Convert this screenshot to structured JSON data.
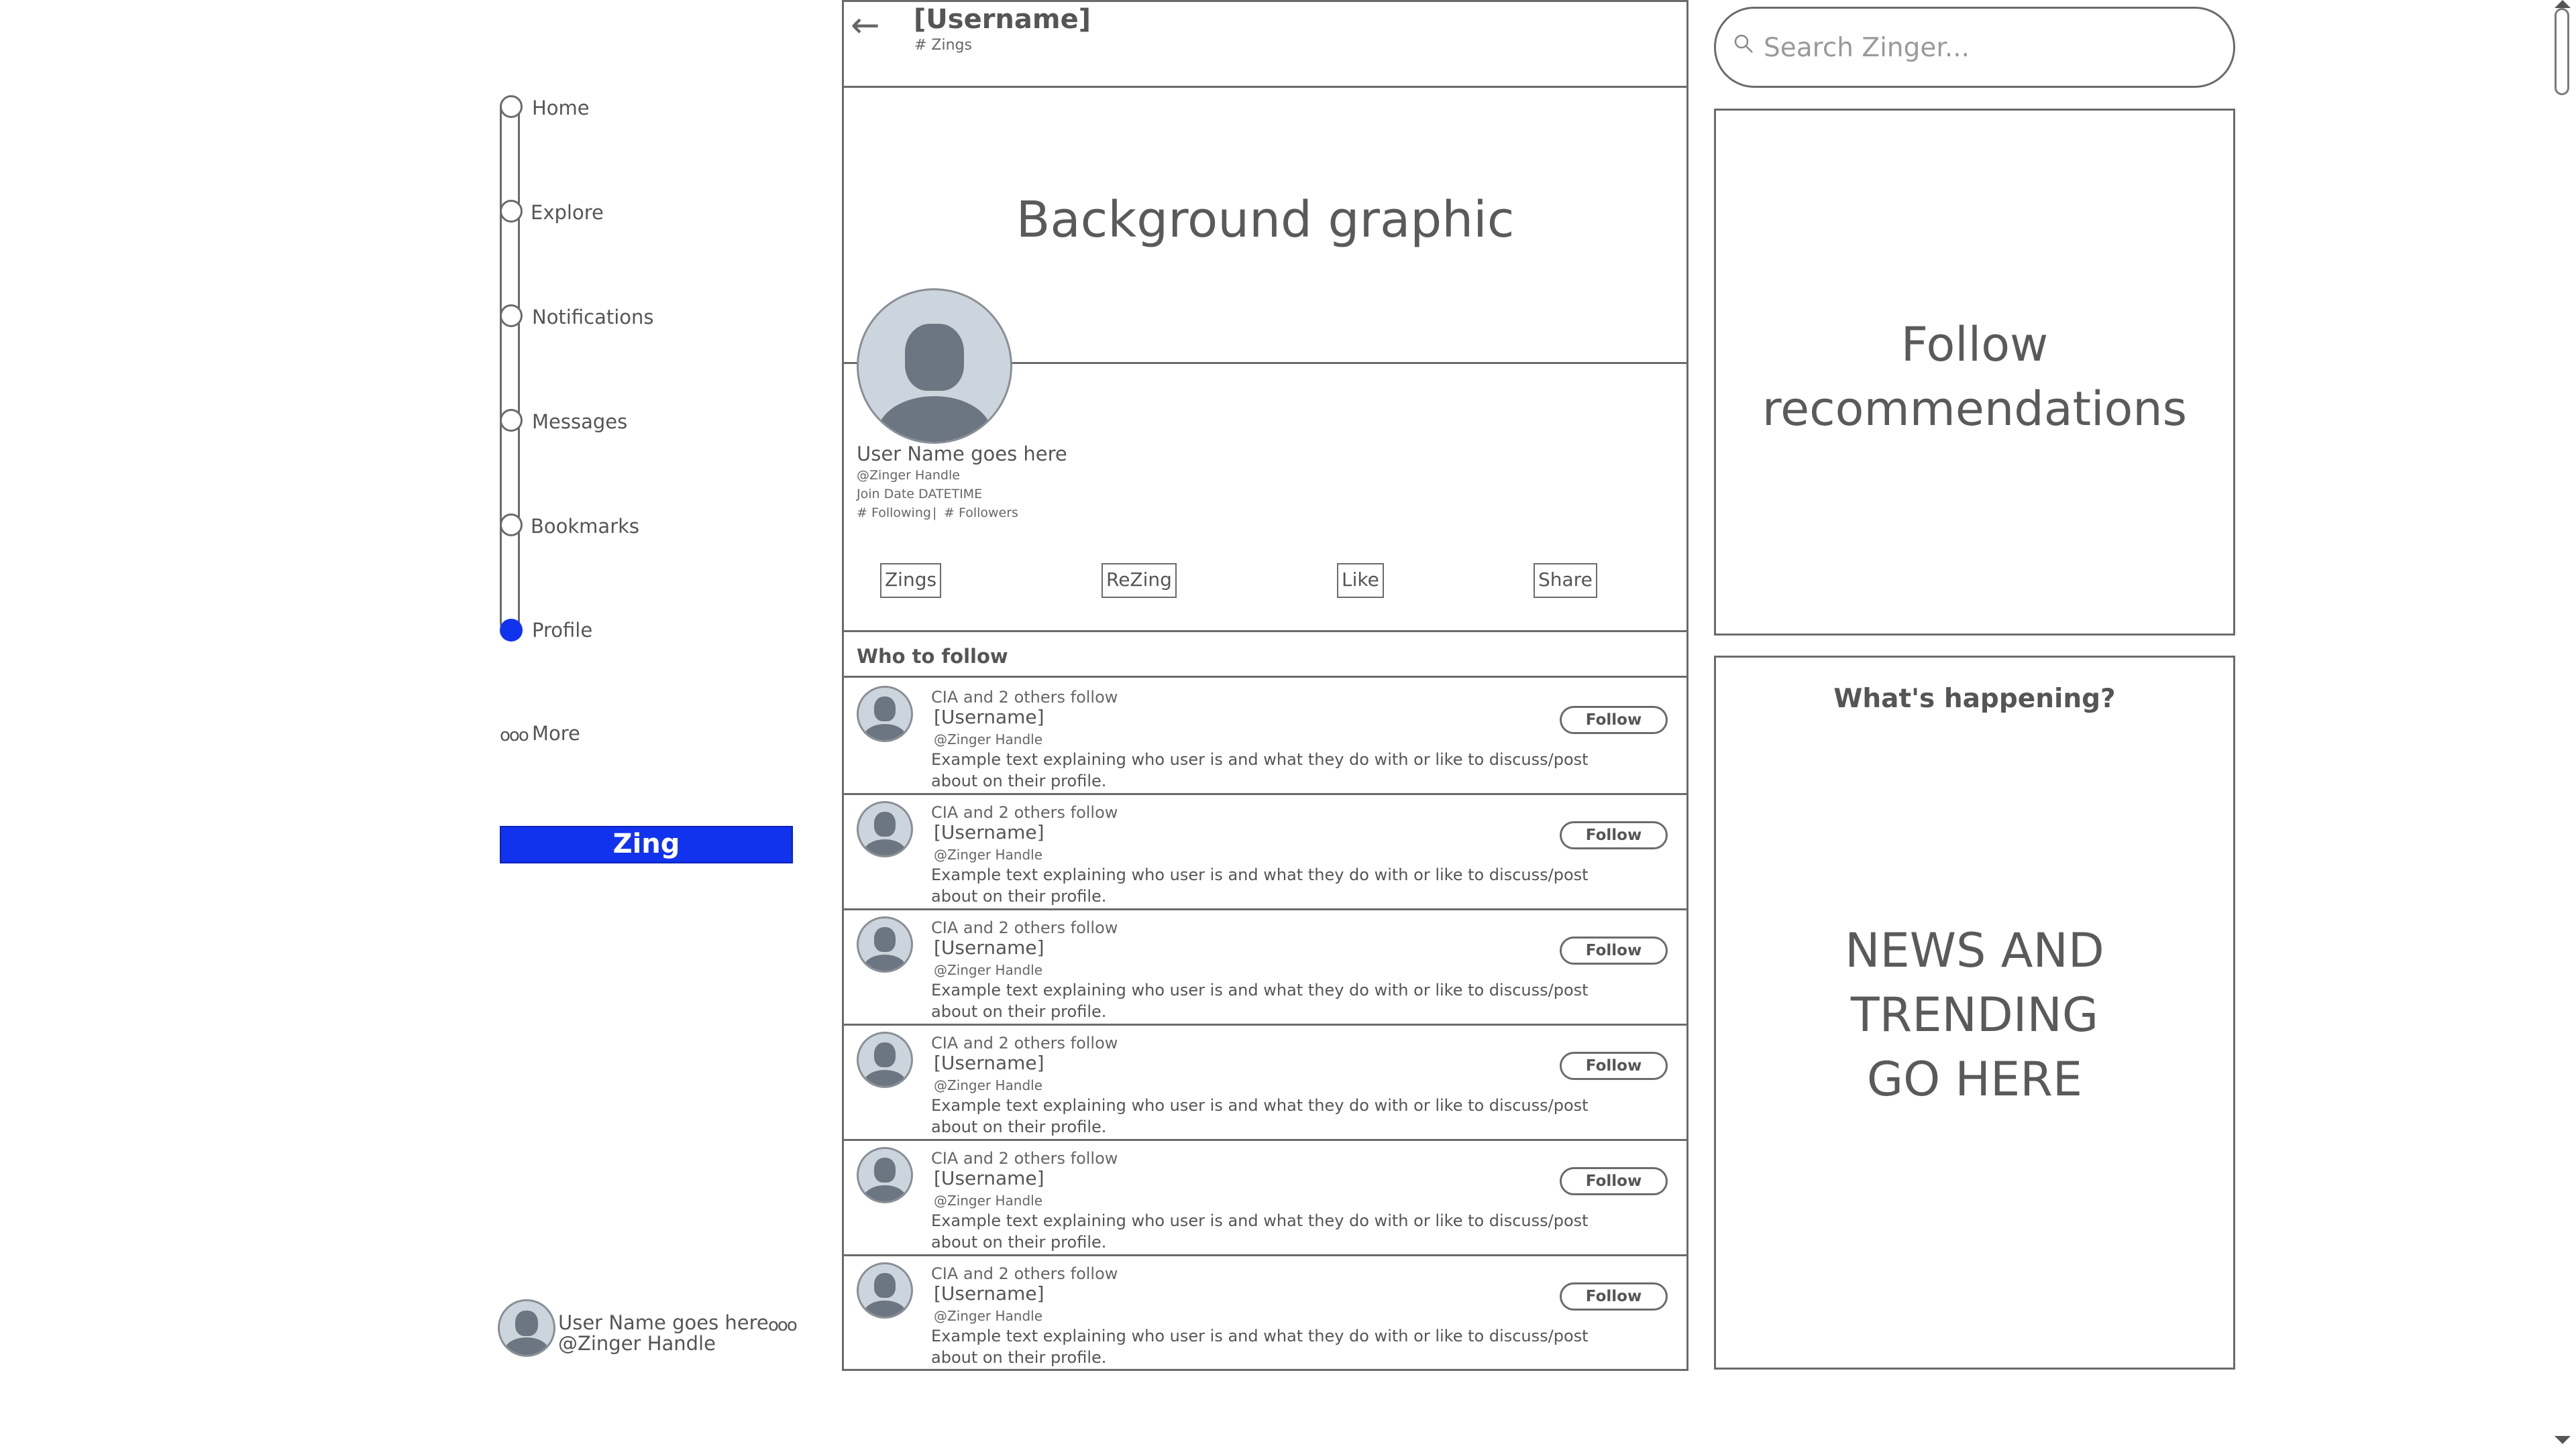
{
  "nav": {
    "items": [
      {
        "label": "Home",
        "icon": "circle-icon"
      },
      {
        "label": "Explore",
        "icon": "circle-icon"
      },
      {
        "label": "Notifications",
        "icon": "circle-icon"
      },
      {
        "label": "Messages",
        "icon": "circle-icon"
      },
      {
        "label": "Bookmarks",
        "icon": "circle-icon"
      },
      {
        "label": "Profile",
        "icon": "circle-icon",
        "active": true
      }
    ],
    "more_icon": "ooo",
    "more_label": "More",
    "zing_button": "Zing",
    "account_name": "User Name goes here",
    "account_handle": "@Zinger Handle",
    "account_menu_icon": "ooo"
  },
  "header": {
    "back_icon": "←",
    "username": "[Username]",
    "zing_count": "# Zings"
  },
  "profile": {
    "background_label": "Background graphic",
    "name": "User Name goes here",
    "handle": "@Zinger Handle",
    "join_date": "Join Date DATETIME",
    "following": "# Following",
    "separator": "|",
    "followers": "# Followers",
    "tabs": [
      "Zings",
      "ReZing",
      "Like",
      "Share"
    ]
  },
  "who_to_follow": {
    "title": "Who to follow",
    "follow_label": "Follow",
    "rows": [
      {
        "context": "CIA and 2 others follow",
        "username": "[Username]",
        "handle": "@Zinger Handle",
        "bio": "Example text explaining who user is and what they do with or like to discuss/post about on their profile."
      },
      {
        "context": "CIA and 2 others follow",
        "username": "[Username]",
        "handle": "@Zinger Handle",
        "bio": "Example text explaining who user is and what they do with or like to discuss/post about on their profile."
      },
      {
        "context": "CIA and 2 others follow",
        "username": "[Username]",
        "handle": "@Zinger Handle",
        "bio": "Example text explaining who user is and what they do with or like to discuss/post about on their profile."
      },
      {
        "context": "CIA and 2 others follow",
        "username": "[Username]",
        "handle": "@Zinger Handle",
        "bio": "Example text explaining who user is and what they do with or like to discuss/post about on their profile."
      },
      {
        "context": "CIA and 2 others follow",
        "username": "[Username]",
        "handle": "@Zinger Handle",
        "bio": "Example text explaining who user is and what they do with or like to discuss/post about on their profile."
      },
      {
        "context": "CIA and 2 others follow",
        "username": "[Username]",
        "handle": "@Zinger Handle",
        "bio": "Example text explaining who user is and what they do with or like to discuss/post about on their profile."
      }
    ]
  },
  "sidebar": {
    "search_placeholder": "Search Zinger...",
    "follow_recs_line1": "Follow",
    "follow_recs_line2": "recommendations",
    "whats_happening": "What's happening?",
    "news_line1": "NEWS AND",
    "news_line2": "TRENDING",
    "news_line3": "GO HERE"
  },
  "colors": {
    "accent": "#1233ee",
    "line": "#6b6b6b",
    "text": "#555555",
    "avatar_bg": "#ccd5dd",
    "avatar_fg": "#6c7682"
  }
}
